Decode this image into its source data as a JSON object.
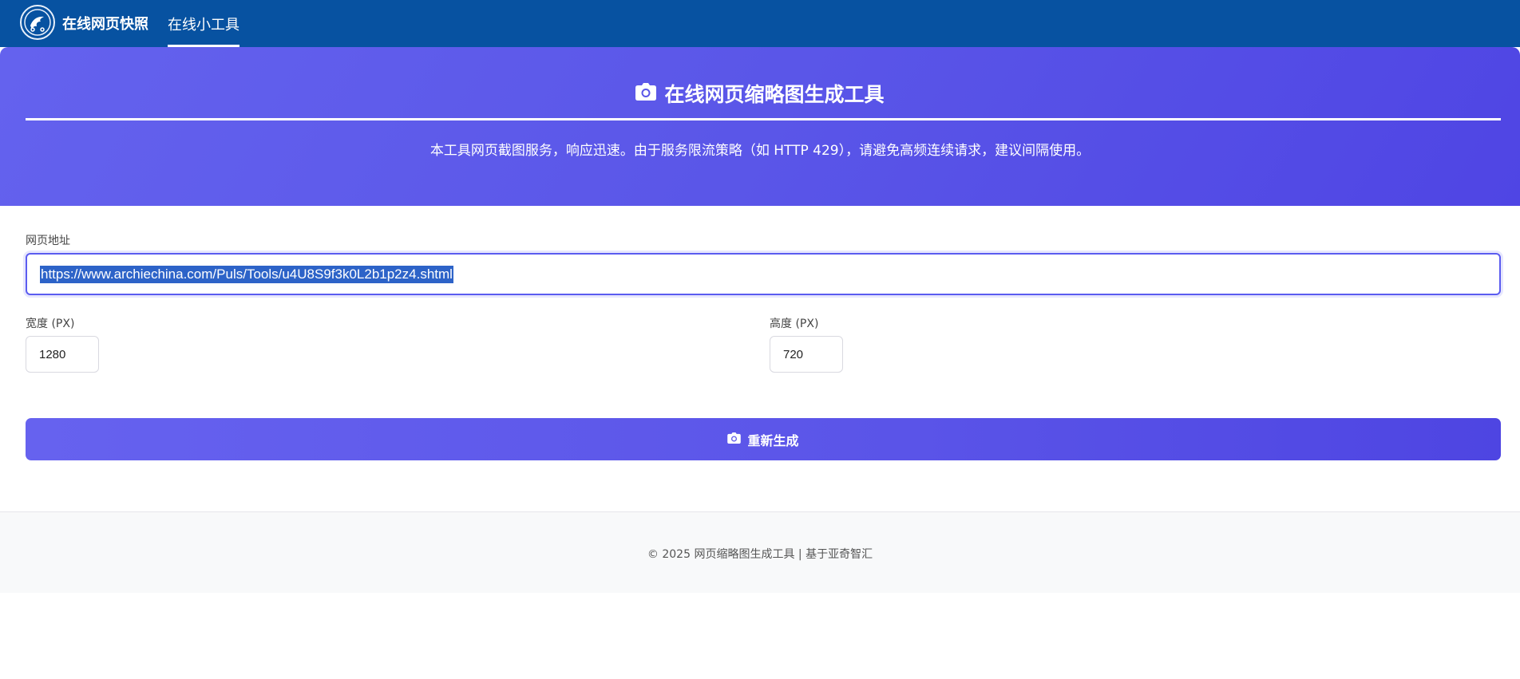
{
  "nav": {
    "brand": "在线网页快照",
    "items": [
      {
        "label": "在线小工具",
        "active": true
      }
    ]
  },
  "hero": {
    "icon": "camera-icon",
    "title": "在线网页缩略图生成工具",
    "description": "本工具网页截图服务，响应迅速。由于服务限流策略（如 HTTP 429），请避免高频连续请求，建议间隔使用。"
  },
  "form": {
    "url_label": "网页地址",
    "url_value": "https://www.archiechina.com/Puls/Tools/u4U8S9f3k0L2b1p2z4.shtml",
    "width_label": "宽度 (PX)",
    "width_value": "1280",
    "height_label": "高度 (PX)",
    "height_value": "720",
    "submit_label": "重新生成",
    "submit_icon": "camera-icon"
  },
  "footer": {
    "text": "© 2025 网页缩略图生成工具 | 基于亚奇智汇"
  },
  "colors": {
    "nav_bg": "#0752a1",
    "hero_gradient_start": "#6462ee",
    "hero_gradient_end": "#4f45e4",
    "accent": "#5b5cf0",
    "selection": "#2d63c8"
  }
}
